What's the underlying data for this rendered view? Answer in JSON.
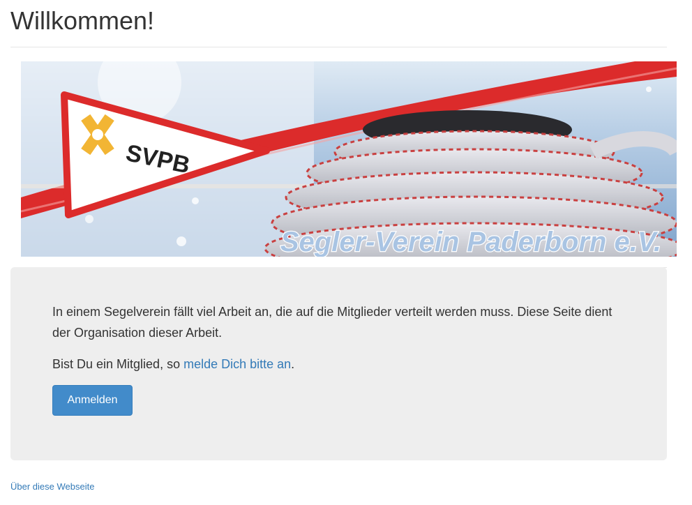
{
  "header": {
    "title": "Willkommen!"
  },
  "banner": {
    "pennant_text": "SVPB",
    "club_name": "Segler-Verein Paderborn e.V.",
    "colors": {
      "red": "#dc2b2b",
      "sea": "#8fb3d6",
      "logo_yellow": "#f2b534"
    }
  },
  "main": {
    "intro": "In einem Segelverein fällt viel Arbeit an, die auf die Mitglieder verteilt werden muss. Diese Seite dient der Organisation dieser Arbeit.",
    "member_prefix": "Bist Du ein Mitglied, so ",
    "member_link": "melde Dich bitte an",
    "member_suffix": ".",
    "login_button": "Anmelden"
  },
  "footer": {
    "about_link": "Über diese Webseite"
  }
}
